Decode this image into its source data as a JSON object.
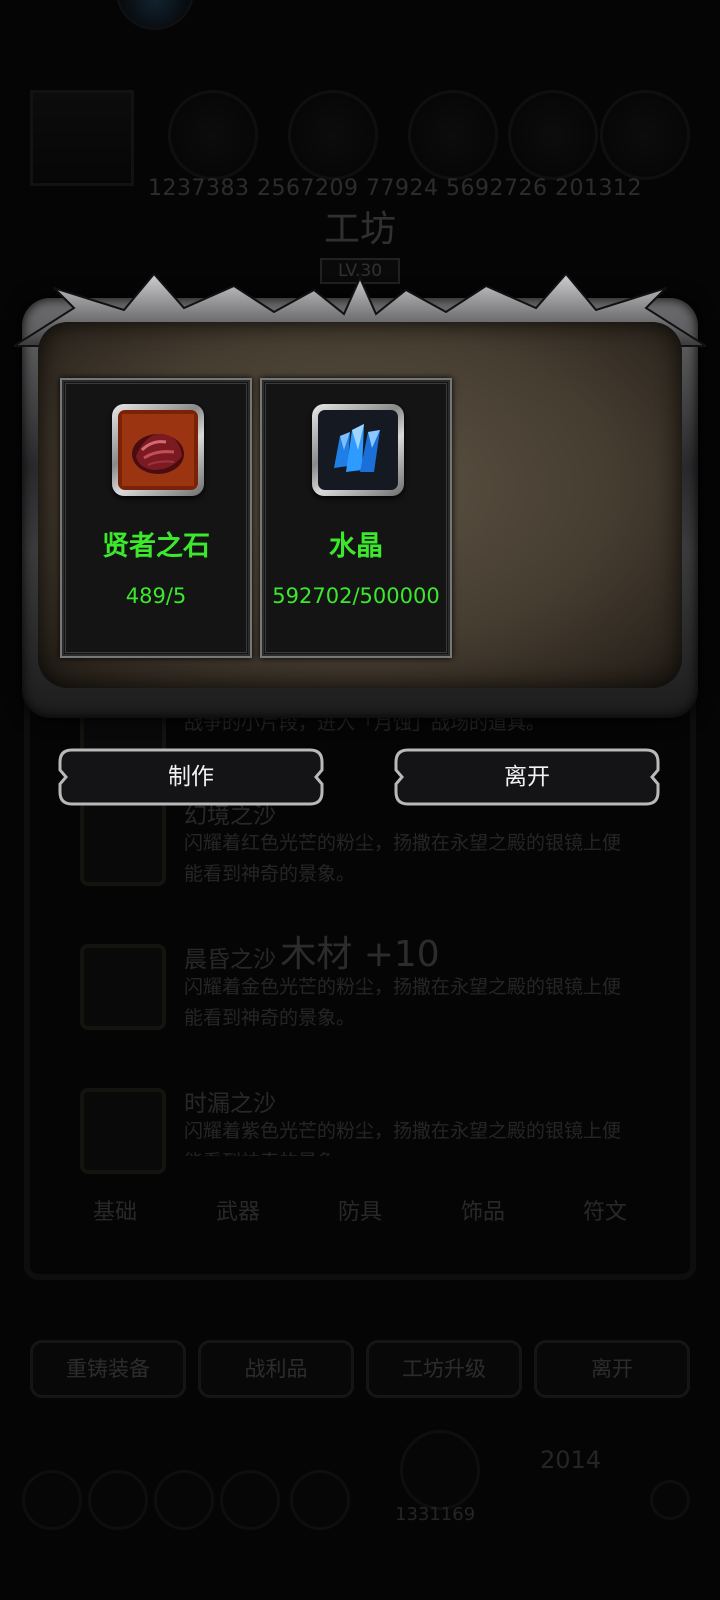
{
  "background": {
    "resources": [
      "1237383",
      "2567209",
      "77924",
      "5692726",
      "201312"
    ],
    "workshop_title": "工坊",
    "workshop_level": "LV.30",
    "items": [
      {
        "name": "",
        "desc": "战争的小片段，进入「月蚀」战场的道具。"
      },
      {
        "name": "幻境之沙",
        "desc": "闪耀着红色光芒的粉尘，扬撒在永望之殿的银镜上便能看到神奇的景象。"
      },
      {
        "name": "晨昏之沙",
        "desc": "闪耀着金色光芒的粉尘，扬撒在永望之殿的银镜上便能看到神奇的景象。"
      },
      {
        "name": "时漏之沙",
        "desc": "闪耀着紫色光芒的粉尘，扬撒在永望之殿的银镜上便能看到神奇的景象。"
      }
    ],
    "gain_text": "木材 +10",
    "tabs": [
      "基础",
      "武器",
      "防具",
      "饰品",
      "符文"
    ],
    "buttons": [
      "重铸装备",
      "战利品",
      "工坊升级",
      "离开"
    ],
    "bottom_numbers": [
      "1331169",
      "2014"
    ]
  },
  "modal": {
    "materials": [
      {
        "name": "贤者之石",
        "count": "489/5",
        "icon": "sage-stone-icon",
        "color": "#3be82c"
      },
      {
        "name": "水晶",
        "count": "592702/500000",
        "icon": "crystal-icon",
        "color": "#3be82c"
      }
    ],
    "craft_label": "制作",
    "leave_label": "离开"
  }
}
